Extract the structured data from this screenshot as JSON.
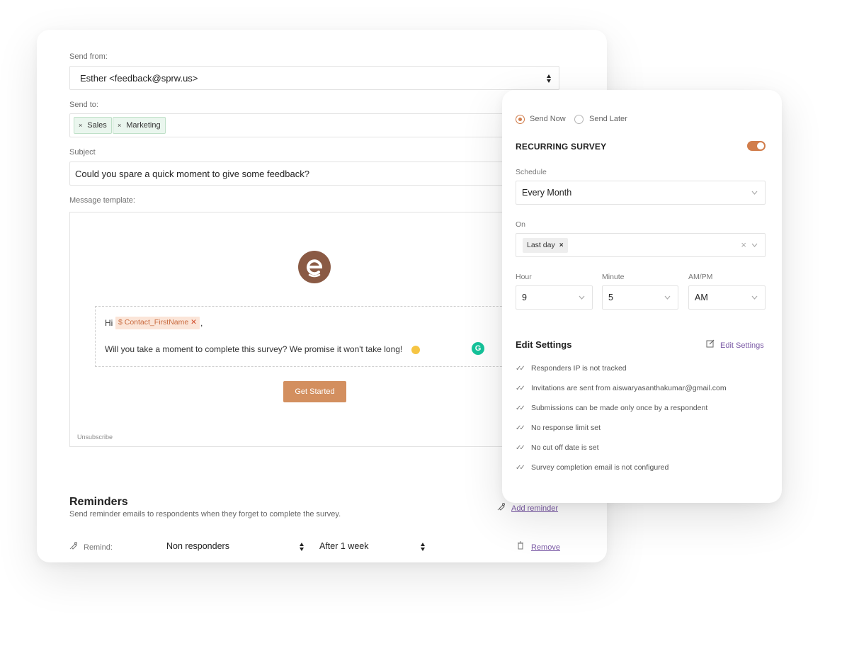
{
  "email": {
    "send_from_label": "Send from:",
    "send_from_value": "Esther <feedback@sprw.us>",
    "send_to_label": "Send to:",
    "send_to_tags": [
      "Sales",
      "Marketing"
    ],
    "subject_label": "Subject",
    "subject_value": "Could you spare a quick moment to give some feedback?",
    "template_label": "Message template:",
    "greeting": "Hi",
    "placeholder_chip": "$ Contact_FirstName",
    "greeting_comma": ",",
    "body": "Will you take a moment to complete this survey? We promise it won't take long!",
    "cta": "Get Started",
    "unsubscribe": "Unsubscribe"
  },
  "reminders": {
    "title": "Reminders",
    "description": "Send reminder emails to respondents when they forget to complete the survey.",
    "add_label": "Add reminder",
    "remind_label": "Remind:",
    "audience": "Non responders",
    "delay": "After 1 week",
    "remove_label": "Remove"
  },
  "settings": {
    "send_now": "Send Now",
    "send_later": "Send Later",
    "recurring_title": "RECURRING SURVEY",
    "recurring_enabled": true,
    "schedule_label": "Schedule",
    "schedule_value": "Every Month",
    "on_label": "On",
    "on_tag": "Last day",
    "hour_label": "Hour",
    "hour_value": "9",
    "minute_label": "Minute",
    "minute_value": "5",
    "ampm_label": "AM/PM",
    "ampm_value": "AM",
    "edit_title": "Edit Settings",
    "edit_link": "Edit Settings",
    "checks": [
      "Responders IP is not tracked",
      "Invitations are sent from aiswaryasanthakumar@gmail.com",
      "Submissions can be made only once by a respondent",
      "No response limit set",
      "No cut off date is set",
      "Survey completion email is not configured"
    ]
  },
  "colors": {
    "accent": "#d17d4b",
    "link": "#7b5aa6",
    "tag_bg": "#eaf6ee",
    "logo": "#8a5a44"
  },
  "icons": {
    "tag_remove": "×",
    "chip_remove": "✕",
    "check": "✓✓",
    "clear": "×"
  }
}
